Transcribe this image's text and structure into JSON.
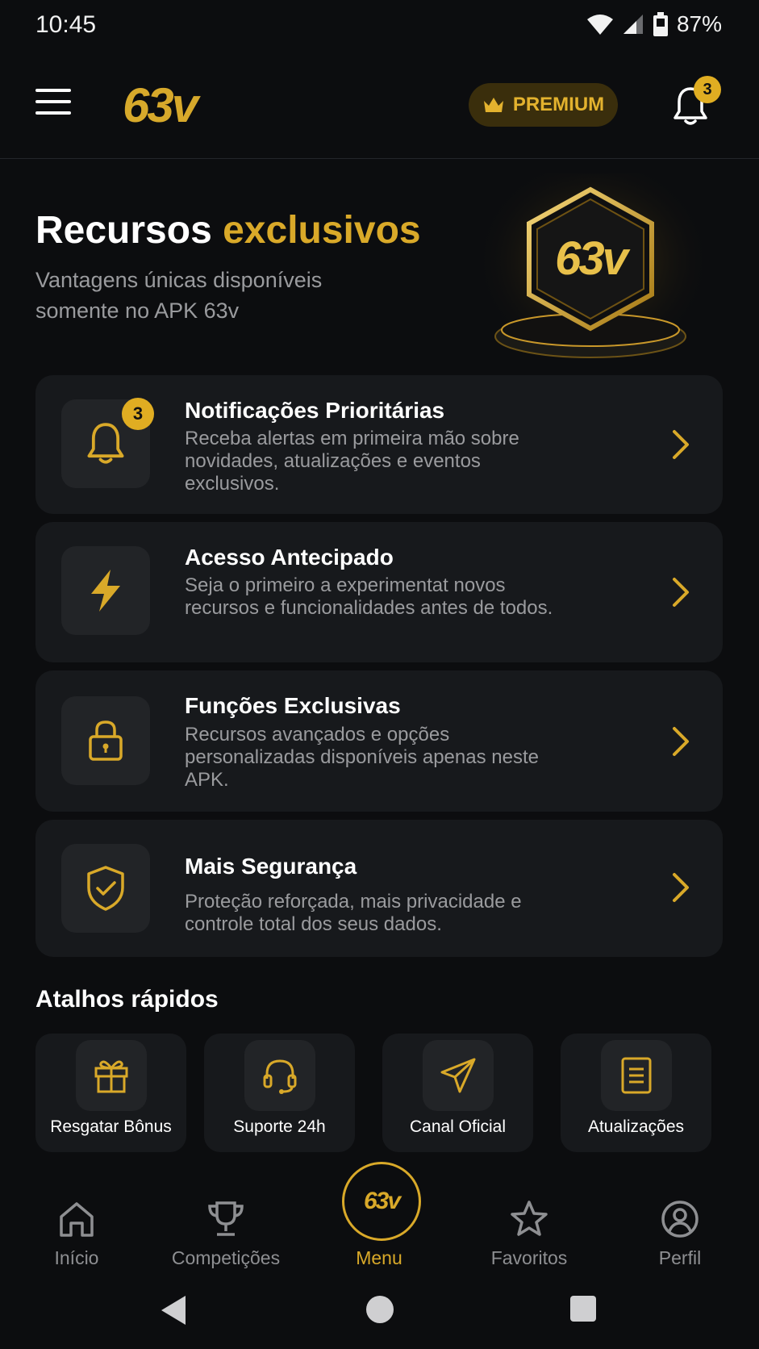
{
  "status_bar": {
    "time": "10:45",
    "battery": "87%"
  },
  "header": {
    "logo": "63v",
    "premium_label": "PREMIUM",
    "notification_count": "3"
  },
  "hero": {
    "title_main": "Recursos",
    "title_accent": "exclusivos",
    "subtitle": "Vantagens únicas disponíveis somente no APK 63v",
    "badge_logo": "63v"
  },
  "features": [
    {
      "title": "Notificações Prioritárias",
      "description": "Receba alertas em primeira mão sobre novidades, atualizações e eventos exclusivos.",
      "icon": "bell-icon",
      "badge": "3"
    },
    {
      "title": "Acesso Antecipado",
      "description": "Seja o primeiro a experimentat novos recursos e funcionalidades antes de todos.",
      "icon": "lightning-icon"
    },
    {
      "title": "Funções Exclusivas",
      "description": "Recursos avançados e opções personalizadas disponíveis apenas neste APK.",
      "icon": "lock-icon"
    },
    {
      "title": "Mais Segurança",
      "description": "Proteção reforçada, mais privacidade e controle total dos seus dados.",
      "icon": "shield-check-icon"
    }
  ],
  "shortcuts": {
    "title": "Atalhos rápidos",
    "items": [
      {
        "label": "Resgatar Bônus",
        "icon": "gift-icon"
      },
      {
        "label": "Suporte 24h",
        "icon": "headset-icon"
      },
      {
        "label": "Canal Oficial",
        "icon": "send-icon"
      },
      {
        "label": "Atualizações",
        "icon": "document-icon"
      }
    ]
  },
  "bottom_nav": {
    "items": [
      {
        "label": "Início",
        "icon": "home-icon"
      },
      {
        "label": "Competições",
        "icon": "trophy-icon"
      },
      {
        "label": "Menu",
        "icon": "logo-icon",
        "active": true
      },
      {
        "label": "Favoritos",
        "icon": "star-icon"
      },
      {
        "label": "Perfil",
        "icon": "profile-icon"
      }
    ],
    "center_logo": "63v"
  },
  "colors": {
    "accent": "#d9a929",
    "background": "#0c0d0f",
    "card": "#17191c",
    "muted_text": "#9a9b9e"
  }
}
